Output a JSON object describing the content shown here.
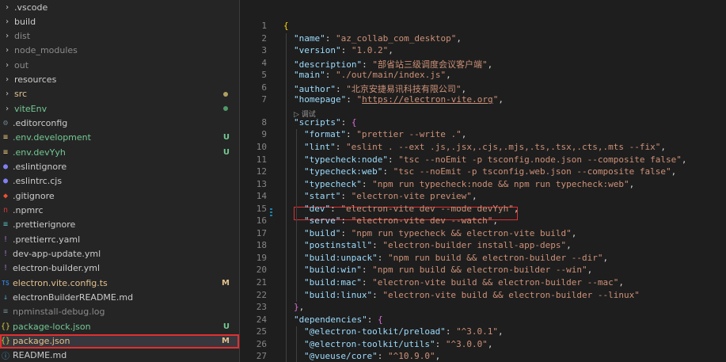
{
  "explorer": {
    "items": [
      {
        "name": ".vscode",
        "type": "folder",
        "status": ""
      },
      {
        "name": "build",
        "type": "folder",
        "status": ""
      },
      {
        "name": "dist",
        "type": "folder",
        "status": "ignored"
      },
      {
        "name": "node_modules",
        "type": "folder",
        "status": "ignored"
      },
      {
        "name": "out",
        "type": "folder",
        "status": "ignored"
      },
      {
        "name": "resources",
        "type": "folder",
        "status": ""
      },
      {
        "name": "src",
        "type": "folder",
        "status": "modified-dot"
      },
      {
        "name": "viteEnv",
        "type": "folder",
        "status": "untracked-dot"
      },
      {
        "name": ".editorconfig",
        "type": "gear",
        "status": ""
      },
      {
        "name": ".env.development",
        "type": "env",
        "status": "untracked",
        "badge": "U"
      },
      {
        "name": ".env.devYyh",
        "type": "env",
        "status": "untracked",
        "badge": "U"
      },
      {
        "name": ".eslintignore",
        "type": "eslint",
        "status": ""
      },
      {
        "name": ".eslintrc.cjs",
        "type": "eslint",
        "status": ""
      },
      {
        "name": ".gitignore",
        "type": "git",
        "status": ""
      },
      {
        "name": ".npmrc",
        "type": "npm",
        "status": ""
      },
      {
        "name": ".prettierignore",
        "type": "prettier",
        "status": ""
      },
      {
        "name": ".prettierrc.yaml",
        "type": "yaml",
        "status": ""
      },
      {
        "name": "dev-app-update.yml",
        "type": "yaml",
        "status": ""
      },
      {
        "name": "electron-builder.yml",
        "type": "yaml",
        "status": ""
      },
      {
        "name": "electron.vite.config.ts",
        "type": "ts",
        "status": "modified",
        "badge": "M"
      },
      {
        "name": "electronBuilderREADME.md",
        "type": "md",
        "status": ""
      },
      {
        "name": "npminstall-debug.log",
        "type": "log",
        "status": "ignored"
      },
      {
        "name": "package-lock.json",
        "type": "json",
        "status": "untracked",
        "badge": "U"
      },
      {
        "name": "package.json",
        "type": "json",
        "status": "modified",
        "badge": "M",
        "selected": true
      },
      {
        "name": "README.md",
        "type": "info",
        "status": ""
      }
    ]
  },
  "editor": {
    "codelens": "▷ 调试",
    "lines": [
      {
        "n": "1",
        "indent": 0,
        "parts": [
          [
            "b1",
            "{"
          ]
        ]
      },
      {
        "n": "2",
        "indent": 1,
        "parts": [
          [
            "k",
            "\"name\""
          ],
          [
            "p",
            ": "
          ],
          [
            "s",
            "\"az_collab_com_desktop\""
          ],
          [
            "p",
            ","
          ]
        ]
      },
      {
        "n": "3",
        "indent": 1,
        "parts": [
          [
            "k",
            "\"version\""
          ],
          [
            "p",
            ": "
          ],
          [
            "s",
            "\"1.0.2\""
          ],
          [
            "p",
            ","
          ]
        ]
      },
      {
        "n": "4",
        "indent": 1,
        "parts": [
          [
            "k",
            "\"description\""
          ],
          [
            "p",
            ": "
          ],
          [
            "s",
            "\"部省站三级调度会议客户端\""
          ],
          [
            "p",
            ","
          ]
        ]
      },
      {
        "n": "5",
        "indent": 1,
        "parts": [
          [
            "k",
            "\"main\""
          ],
          [
            "p",
            ": "
          ],
          [
            "s",
            "\"./out/main/index.js\""
          ],
          [
            "p",
            ","
          ]
        ]
      },
      {
        "n": "6",
        "indent": 1,
        "parts": [
          [
            "k",
            "\"author\""
          ],
          [
            "p",
            ": "
          ],
          [
            "s",
            "\"北京安捷易讯科技有限公司\""
          ],
          [
            "p",
            ","
          ]
        ]
      },
      {
        "n": "7",
        "indent": 1,
        "parts": [
          [
            "k",
            "\"homepage\""
          ],
          [
            "p",
            ": "
          ],
          [
            "s",
            "\""
          ],
          [
            "u",
            "https://electron-vite.org"
          ],
          [
            "s",
            "\""
          ],
          [
            "p",
            ","
          ]
        ]
      },
      {
        "n": "8",
        "indent": 1,
        "parts": [
          [
            "k",
            "\"scripts\""
          ],
          [
            "p",
            ": "
          ],
          [
            "b2",
            "{"
          ]
        ]
      },
      {
        "n": "9",
        "indent": 2,
        "parts": [
          [
            "k",
            "\"format\""
          ],
          [
            "p",
            ": "
          ],
          [
            "s",
            "\"prettier --write .\""
          ],
          [
            "p",
            ","
          ]
        ]
      },
      {
        "n": "10",
        "indent": 2,
        "parts": [
          [
            "k",
            "\"lint\""
          ],
          [
            "p",
            ": "
          ],
          [
            "s",
            "\"eslint . --ext .js,.jsx,.cjs,.mjs,.ts,.tsx,.cts,.mts --fix\""
          ],
          [
            "p",
            ","
          ]
        ]
      },
      {
        "n": "11",
        "indent": 2,
        "parts": [
          [
            "k",
            "\"typecheck:node\""
          ],
          [
            "p",
            ": "
          ],
          [
            "s",
            "\"tsc --noEmit -p tsconfig.node.json --composite false\""
          ],
          [
            "p",
            ","
          ]
        ]
      },
      {
        "n": "12",
        "indent": 2,
        "parts": [
          [
            "k",
            "\"typecheck:web\""
          ],
          [
            "p",
            ": "
          ],
          [
            "s",
            "\"tsc --noEmit -p tsconfig.web.json --composite false\""
          ],
          [
            "p",
            ","
          ]
        ]
      },
      {
        "n": "13",
        "indent": 2,
        "parts": [
          [
            "k",
            "\"typecheck\""
          ],
          [
            "p",
            ": "
          ],
          [
            "s",
            "\"npm run typecheck:node && npm run typecheck:web\""
          ],
          [
            "p",
            ","
          ]
        ]
      },
      {
        "n": "14",
        "indent": 2,
        "parts": [
          [
            "k",
            "\"start\""
          ],
          [
            "p",
            ": "
          ],
          [
            "s",
            "\"electron-vite preview\""
          ],
          [
            "p",
            ","
          ]
        ]
      },
      {
        "n": "15",
        "indent": 2,
        "parts": [
          [
            "k",
            "\"dev\""
          ],
          [
            "p",
            ": "
          ],
          [
            "s",
            "\"electron-vite dev --mode devYyh\""
          ],
          [
            "p",
            ","
          ]
        ]
      },
      {
        "n": "16",
        "indent": 2,
        "parts": [
          [
            "k",
            "\"serve\""
          ],
          [
            "p",
            ": "
          ],
          [
            "s",
            "\"electron-vite dev --watch\""
          ],
          [
            "p",
            ","
          ]
        ]
      },
      {
        "n": "17",
        "indent": 2,
        "parts": [
          [
            "k",
            "\"build\""
          ],
          [
            "p",
            ": "
          ],
          [
            "s",
            "\"npm run typecheck && electron-vite build\""
          ],
          [
            "p",
            ","
          ]
        ]
      },
      {
        "n": "18",
        "indent": 2,
        "parts": [
          [
            "k",
            "\"postinstall\""
          ],
          [
            "p",
            ": "
          ],
          [
            "s",
            "\"electron-builder install-app-deps\""
          ],
          [
            "p",
            ","
          ]
        ]
      },
      {
        "n": "19",
        "indent": 2,
        "parts": [
          [
            "k",
            "\"build:unpack\""
          ],
          [
            "p",
            ": "
          ],
          [
            "s",
            "\"npm run build && electron-builder --dir\""
          ],
          [
            "p",
            ","
          ]
        ]
      },
      {
        "n": "20",
        "indent": 2,
        "parts": [
          [
            "k",
            "\"build:win\""
          ],
          [
            "p",
            ": "
          ],
          [
            "s",
            "\"npm run build && electron-builder --win\""
          ],
          [
            "p",
            ","
          ]
        ]
      },
      {
        "n": "21",
        "indent": 2,
        "parts": [
          [
            "k",
            "\"build:mac\""
          ],
          [
            "p",
            ": "
          ],
          [
            "s",
            "\"electron-vite build && electron-builder --mac\""
          ],
          [
            "p",
            ","
          ]
        ]
      },
      {
        "n": "22",
        "indent": 2,
        "parts": [
          [
            "k",
            "\"build:linux\""
          ],
          [
            "p",
            ": "
          ],
          [
            "s",
            "\"electron-vite build && electron-builder --linux\""
          ]
        ]
      },
      {
        "n": "23",
        "indent": 1,
        "parts": [
          [
            "b2",
            "}"
          ],
          [
            "p",
            ","
          ]
        ]
      },
      {
        "n": "24",
        "indent": 1,
        "parts": [
          [
            "k",
            "\"dependencies\""
          ],
          [
            "p",
            ": "
          ],
          [
            "b2",
            "{"
          ]
        ]
      },
      {
        "n": "25",
        "indent": 2,
        "parts": [
          [
            "k",
            "\"@electron-toolkit/preload\""
          ],
          [
            "p",
            ": "
          ],
          [
            "s",
            "\"^3.0.1\""
          ],
          [
            "p",
            ","
          ]
        ]
      },
      {
        "n": "26",
        "indent": 2,
        "parts": [
          [
            "k",
            "\"@electron-toolkit/utils\""
          ],
          [
            "p",
            ": "
          ],
          [
            "s",
            "\"^3.0.0\""
          ],
          [
            "p",
            ","
          ]
        ]
      },
      {
        "n": "27",
        "indent": 2,
        "parts": [
          [
            "k",
            "\"@vueuse/core\""
          ],
          [
            "p",
            ": "
          ],
          [
            "s",
            "\"^10.9.0\""
          ],
          [
            "p",
            ","
          ]
        ]
      }
    ]
  }
}
